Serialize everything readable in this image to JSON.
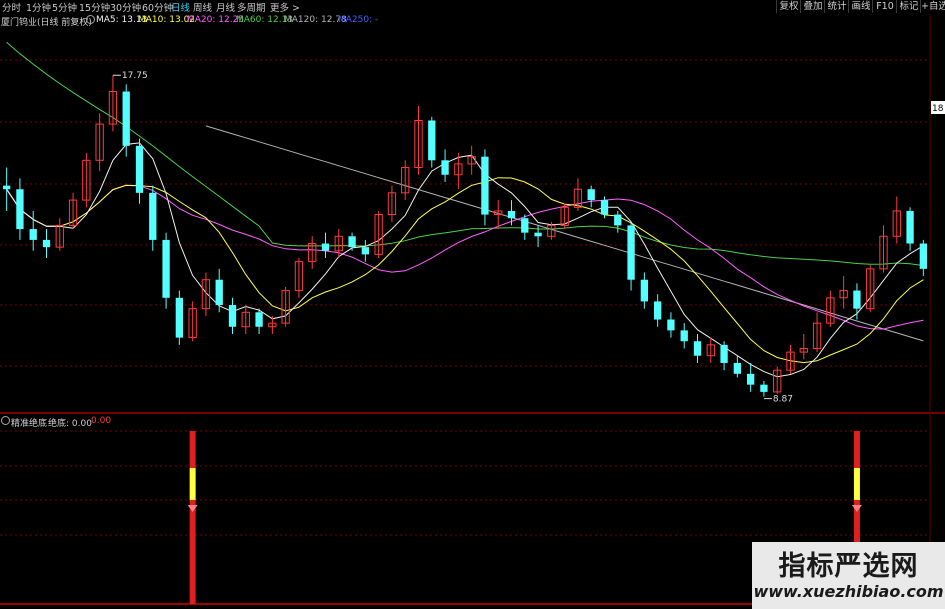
{
  "toolbar": {
    "tabs": [
      {
        "label": "分时",
        "active": false
      },
      {
        "label": "1分钟",
        "active": false
      },
      {
        "label": "5分钟",
        "active": false
      },
      {
        "label": "15分钟",
        "active": false
      },
      {
        "label": "30分钟",
        "active": false
      },
      {
        "label": "60分钟",
        "active": false
      },
      {
        "label": "日线",
        "active": true
      },
      {
        "label": "周线",
        "active": false
      },
      {
        "label": "月线",
        "active": false
      },
      {
        "label": "多周期",
        "active": false
      },
      {
        "label": "更多 >",
        "active": false
      }
    ],
    "right_buttons": [
      "复权",
      "叠加",
      "统计",
      "画线",
      "F10",
      "标记",
      "+自选"
    ]
  },
  "info": {
    "stock_title": "厦门钨业(日线 前复权)",
    "ma5": "MA5: 13.13",
    "ma10": "MA10: 13.02",
    "ma20": "MA20: 12.25",
    "ma60": "MA60: 12.13",
    "ma120": "MA120: 12.78",
    "ma250": "MA250: -"
  },
  "price_labels": {
    "high": "17.75",
    "low": "8.87",
    "axis_tag": "18"
  },
  "indicator": {
    "name": "精准绝底",
    "label": "绝底: 0.00",
    "value2": "0.00"
  },
  "watermark": {
    "title": "指标严选网",
    "url": "www.xuezhibiao.com"
  },
  "colors": {
    "up": "#ff3b3b",
    "down": "#54ffff",
    "ma5": "#f0f0f0",
    "ma10": "#ffff50",
    "ma20": "#ff60ff",
    "ma60": "#4cd04c",
    "ma120": "#b4b4b4",
    "ma250": "#4060ff",
    "grid": "#7a0000",
    "background": "#000000"
  },
  "chart_data": {
    "type": "candlestick",
    "series_count": 70,
    "candles": [
      [
        14.7,
        15.2,
        14.0,
        14.6
      ],
      [
        14.6,
        14.9,
        13.2,
        13.5
      ],
      [
        13.5,
        14.0,
        12.9,
        13.2
      ],
      [
        13.2,
        13.5,
        12.7,
        13.0
      ],
      [
        13.0,
        13.8,
        12.9,
        13.6
      ],
      [
        13.6,
        14.5,
        13.5,
        14.3
      ],
      [
        14.3,
        15.6,
        14.1,
        15.4
      ],
      [
        15.4,
        16.7,
        15.1,
        16.4
      ],
      [
        16.4,
        17.75,
        16.2,
        17.3
      ],
      [
        17.3,
        17.5,
        15.5,
        15.8
      ],
      [
        15.8,
        16.0,
        14.2,
        14.5
      ],
      [
        14.5,
        14.7,
        12.9,
        13.2
      ],
      [
        13.2,
        13.4,
        11.3,
        11.6
      ],
      [
        11.6,
        11.8,
        10.3,
        10.5
      ],
      [
        10.5,
        11.5,
        10.4,
        11.3
      ],
      [
        11.3,
        12.3,
        11.1,
        12.1
      ],
      [
        12.1,
        12.4,
        11.2,
        11.4
      ],
      [
        11.4,
        11.6,
        10.6,
        10.8
      ],
      [
        10.8,
        11.4,
        10.6,
        11.2
      ],
      [
        11.2,
        11.3,
        10.6,
        10.8
      ],
      [
        10.8,
        11.1,
        10.6,
        10.9
      ],
      [
        10.9,
        11.9,
        10.8,
        11.8
      ],
      [
        11.8,
        12.7,
        11.6,
        12.6
      ],
      [
        12.6,
        13.3,
        12.4,
        13.1
      ],
      [
        13.1,
        13.4,
        12.7,
        12.9
      ],
      [
        12.9,
        13.5,
        12.7,
        13.3
      ],
      [
        13.3,
        13.4,
        12.9,
        13.0
      ],
      [
        13.0,
        13.2,
        12.6,
        12.8
      ],
      [
        12.8,
        14.0,
        12.7,
        13.9
      ],
      [
        13.9,
        14.7,
        13.7,
        14.5
      ],
      [
        14.5,
        15.4,
        14.3,
        15.2
      ],
      [
        15.2,
        16.9,
        15.0,
        16.5
      ],
      [
        16.5,
        16.6,
        15.2,
        15.4
      ],
      [
        15.4,
        15.7,
        14.8,
        15.0
      ],
      [
        15.0,
        15.6,
        14.6,
        15.3
      ],
      [
        15.3,
        15.8,
        15.0,
        15.5
      ],
      [
        15.5,
        15.7,
        13.6,
        13.9
      ],
      [
        13.9,
        14.3,
        13.5,
        14.0
      ],
      [
        14.0,
        14.3,
        13.6,
        13.8
      ],
      [
        13.8,
        13.9,
        13.2,
        13.4
      ],
      [
        13.4,
        13.6,
        13.0,
        13.3
      ],
      [
        13.3,
        13.7,
        13.2,
        13.6
      ],
      [
        13.6,
        14.2,
        13.5,
        14.1
      ],
      [
        14.1,
        14.9,
        14.0,
        14.6
      ],
      [
        14.6,
        14.7,
        14.1,
        14.3
      ],
      [
        14.3,
        14.4,
        13.8,
        13.9
      ],
      [
        13.9,
        14.0,
        13.4,
        13.6
      ],
      [
        13.6,
        13.7,
        11.8,
        12.1
      ],
      [
        12.1,
        12.3,
        11.3,
        11.5
      ],
      [
        11.5,
        11.7,
        10.8,
        11.0
      ],
      [
        11.0,
        11.2,
        10.5,
        10.7
      ],
      [
        10.7,
        10.9,
        10.2,
        10.4
      ],
      [
        10.4,
        10.6,
        9.8,
        10.0
      ],
      [
        10.0,
        10.5,
        9.8,
        10.3
      ],
      [
        10.3,
        10.4,
        9.6,
        9.8
      ],
      [
        9.8,
        10.0,
        9.4,
        9.5
      ],
      [
        9.5,
        9.8,
        9.0,
        9.2
      ],
      [
        9.2,
        9.3,
        8.87,
        9.0
      ],
      [
        9.0,
        9.7,
        8.95,
        9.6
      ],
      [
        9.6,
        10.3,
        9.5,
        10.1
      ],
      [
        10.1,
        10.6,
        9.9,
        10.2
      ],
      [
        10.2,
        11.2,
        10.1,
        10.9
      ],
      [
        10.9,
        11.8,
        10.8,
        11.6
      ],
      [
        11.6,
        12.2,
        11.3,
        11.8
      ],
      [
        11.8,
        12.0,
        11.0,
        11.3
      ],
      [
        11.3,
        12.5,
        11.2,
        12.4
      ],
      [
        12.4,
        13.6,
        12.3,
        13.3
      ],
      [
        13.3,
        14.4,
        13.1,
        14.0
      ],
      [
        14.0,
        14.1,
        12.9,
        13.1
      ],
      [
        13.1,
        13.2,
        12.2,
        12.4
      ]
    ],
    "indicator_signals": [
      14,
      64
    ],
    "ylim": [
      8.5,
      19.0
    ]
  }
}
